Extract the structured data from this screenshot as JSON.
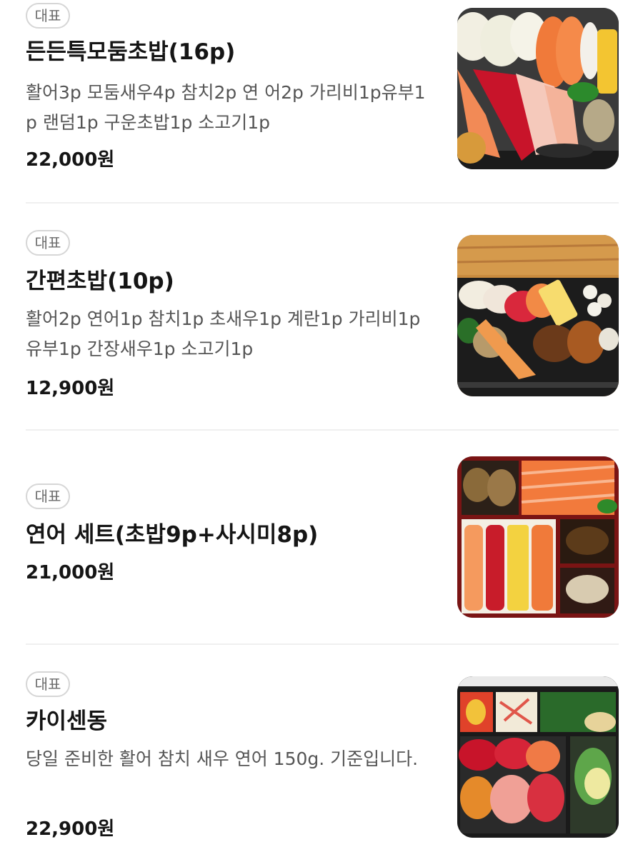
{
  "menu": {
    "items": [
      {
        "badge": "대표",
        "name": "든든특모둠초밥(16p)",
        "description": "활어3p 모둠새우4p 참치2p 연 어2p 가리비1p유부1p 랜덤1p 구운초밥1p 소고기1p",
        "price": "22,000원",
        "image": "sushi-platter-16p-photo"
      },
      {
        "badge": "대표",
        "name": "간편초밥(10p)",
        "description": "활어2p 연어1p 참치1p 초새우1p 계란1p 가리비1p유부1p 간장새우1p 소고기1p",
        "price": "12,900원",
        "image": "simple-sushi-10p-photo"
      },
      {
        "badge": "대표",
        "name": "연어 세트(초밥9p+사시미8p)",
        "description": "",
        "price": "21,000원",
        "image": "salmon-set-photo"
      },
      {
        "badge": "대표",
        "name": "카이센동",
        "description": "당일 준비한 활어 참치 새우 연어 150g. 기준입니다.",
        "price": "22,900원",
        "image": "kaisendon-photo"
      }
    ]
  }
}
